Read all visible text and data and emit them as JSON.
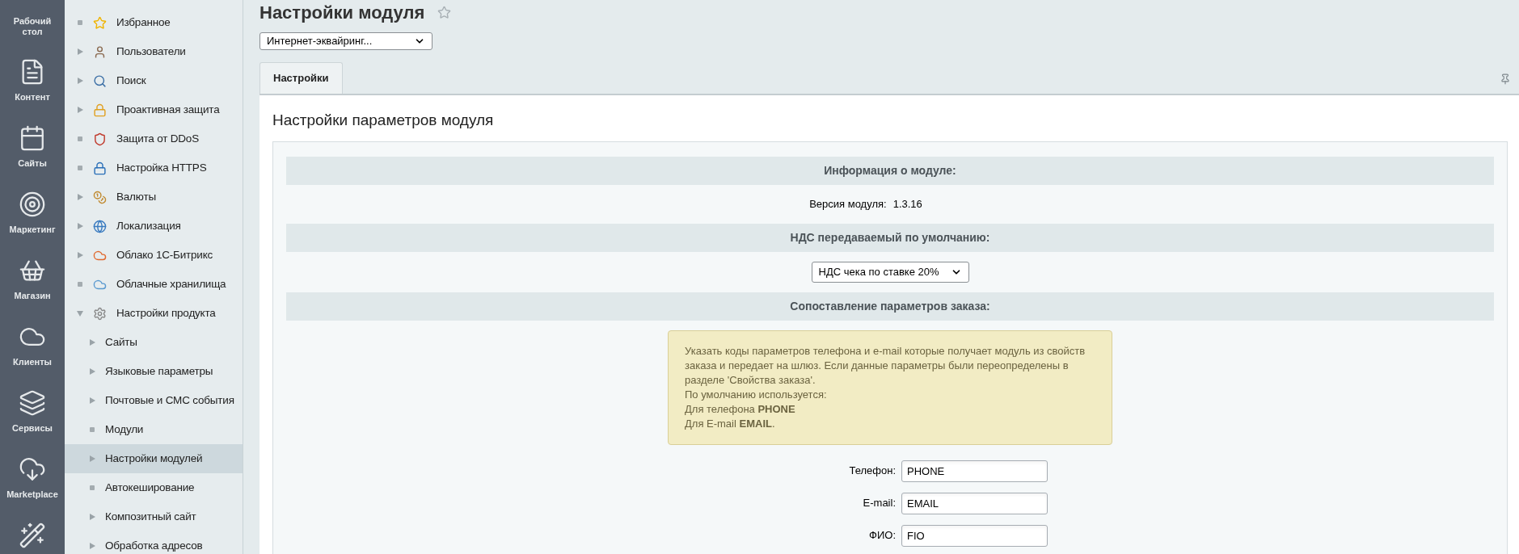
{
  "left_nav": [
    {
      "label": "Рабочий стол"
    },
    {
      "label": "Контент"
    },
    {
      "label": "Сайты"
    },
    {
      "label": "Маркетинг"
    },
    {
      "label": "Магазин"
    },
    {
      "label": "Клиенты"
    },
    {
      "label": "Сервисы"
    },
    {
      "label": "Marketplace"
    }
  ],
  "tree": [
    {
      "label": "Избранное",
      "kind": "leaf",
      "selected": false
    },
    {
      "label": "Пользователи",
      "kind": "folder",
      "expanded": false,
      "selected": false
    },
    {
      "label": "Поиск",
      "kind": "folder",
      "expanded": false,
      "selected": false
    },
    {
      "label": "Проактивная защита",
      "kind": "folder",
      "expanded": false,
      "selected": false
    },
    {
      "label": "Защита от DDoS",
      "kind": "leaf",
      "selected": false
    },
    {
      "label": "Настройка HTTPS",
      "kind": "leaf",
      "selected": false
    },
    {
      "label": "Валюты",
      "kind": "folder",
      "expanded": false,
      "selected": false
    },
    {
      "label": "Локализация",
      "kind": "folder",
      "expanded": false,
      "selected": false
    },
    {
      "label": "Облако 1С-Битрикс",
      "kind": "folder",
      "expanded": false,
      "selected": false
    },
    {
      "label": "Облачные хранилища",
      "kind": "leaf",
      "selected": false
    },
    {
      "label": "Настройки продукта",
      "kind": "folder",
      "expanded": true,
      "selected": false,
      "children": [
        {
          "label": "Сайты",
          "kind": "folder",
          "expanded": false,
          "selected": false
        },
        {
          "label": "Языковые параметры",
          "kind": "folder",
          "expanded": false,
          "selected": false
        },
        {
          "label": "Почтовые и СМС события",
          "kind": "folder",
          "expanded": false,
          "selected": false
        },
        {
          "label": "Модули",
          "kind": "leaf",
          "selected": false
        },
        {
          "label": "Настройки модулей",
          "kind": "folder",
          "expanded": false,
          "selected": true
        },
        {
          "label": "Автокеширование",
          "kind": "leaf",
          "selected": false
        },
        {
          "label": "Композитный сайт",
          "kind": "folder",
          "expanded": false,
          "selected": false
        },
        {
          "label": "Обработка адресов",
          "kind": "folder",
          "expanded": false,
          "selected": false
        }
      ]
    }
  ],
  "page": {
    "title": "Настройки модуля",
    "module_select": "Интернет-эквайринг..."
  },
  "tabs": [
    {
      "label": "Настройки",
      "selected": true
    }
  ],
  "panel": {
    "heading": "Настройки параметров модуля",
    "sections": [
      {
        "kind": "header",
        "text": "Информация о модуле:"
      },
      {
        "kind": "info",
        "label": "Версия модуля:",
        "value": "1.3.16"
      },
      {
        "kind": "header",
        "text": "НДС передаваемый по умолчанию:"
      },
      {
        "kind": "select",
        "value": "НДС чека по ставке 20%"
      },
      {
        "kind": "header",
        "text": "Сопоставление параметров заказа:"
      },
      {
        "kind": "note",
        "lines": [
          "Указать коды параметров телефона и e-mail которые получает модуль из свойств заказа и передает на шлюз. Если данные параметры были переопределены в разделе 'Свойства заказа'.",
          "По умолчанию используется:",
          "Для телефона **PHONE**",
          "Для E-mail **EMAIL**."
        ]
      },
      {
        "kind": "field",
        "label": "Телефон:",
        "value": "PHONE"
      },
      {
        "kind": "field",
        "label": "E-mail:",
        "value": "EMAIL"
      },
      {
        "kind": "field",
        "label": "ФИО:",
        "value": "FIO"
      }
    ]
  }
}
